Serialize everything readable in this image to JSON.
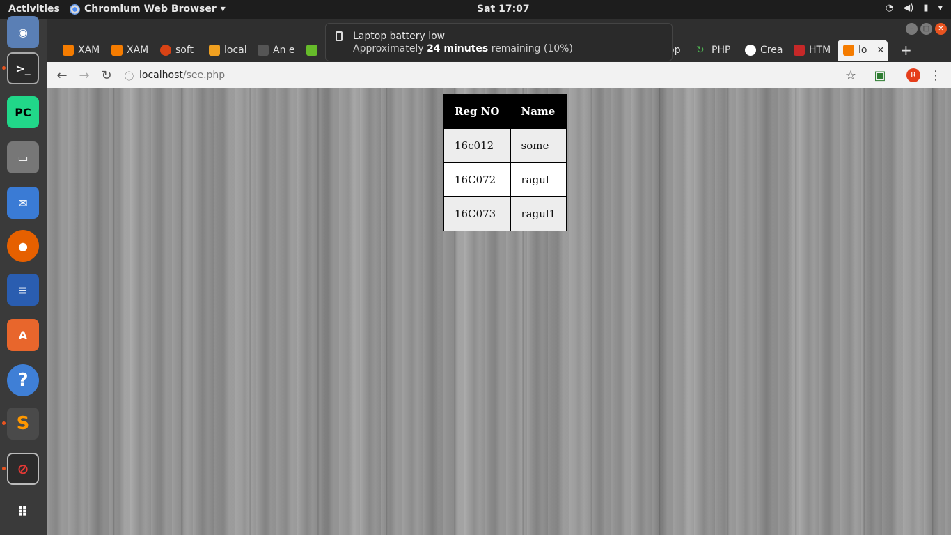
{
  "topbar": {
    "activities": "Activities",
    "app_name": "Chromium Web Browser",
    "clock": "Sat 17:07"
  },
  "notification": {
    "title": "Laptop battery low",
    "prefix": "Approximately",
    "highlight": "24 minutes",
    "suffix": "remaining (10%)"
  },
  "tabs": [
    {
      "label": "XAM",
      "color": "#f57c00"
    },
    {
      "label": "XAM",
      "color": "#f57c00"
    },
    {
      "label": "soft",
      "color": "#d84315"
    },
    {
      "label": "local",
      "color": "#f0a020"
    },
    {
      "label": "An e",
      "color": "#9e9e9e"
    },
    {
      "label": "",
      "color": "#66bb2a"
    },
    {
      "label": "op",
      "color": "#3a3a3a"
    },
    {
      "label": "PHP",
      "color": "#4caf50"
    },
    {
      "label": "Crea",
      "color": "#4285f4"
    },
    {
      "label": "HTM",
      "color": "#c62828"
    },
    {
      "label": "lo",
      "color": "#f57c00"
    }
  ],
  "omnibox": {
    "host": "localhost",
    "path": "/see.php"
  },
  "avatar_letter": "R",
  "table": {
    "headers": [
      "Reg NO",
      "Name"
    ],
    "rows": [
      [
        "16c012",
        "some"
      ],
      [
        "16C072",
        "ragul"
      ],
      [
        "16C073",
        "ragul1"
      ]
    ]
  },
  "colors": {
    "accent": "#e95420",
    "header_bg": "#000000"
  }
}
